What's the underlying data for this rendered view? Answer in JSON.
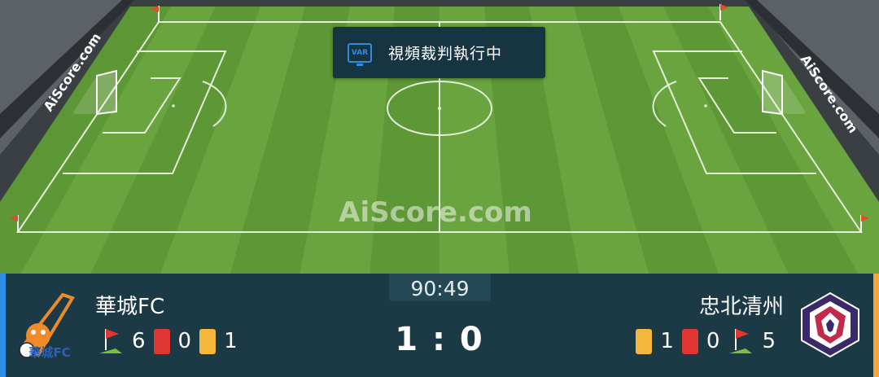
{
  "watermark": "AiScore.com",
  "var_banner": {
    "icon_label": "VAR",
    "text": "視頻裁判執行中"
  },
  "match": {
    "clock": "90:49",
    "score": "1 : 0",
    "home": {
      "name": "華城FC",
      "corners": "6",
      "red_cards": "0",
      "yellow_cards": "1",
      "logo_text": "華城FC"
    },
    "away": {
      "name": "忠北清州",
      "corners": "5",
      "red_cards": "0",
      "yellow_cards": "1"
    }
  },
  "colors": {
    "pitch_light": "#6aa43f",
    "pitch_dark": "#5e9736",
    "scorebar": "#1c3a46",
    "home_accent": "#2f8de4",
    "away_accent": "#f4a83c",
    "red_card": "#e03634",
    "yellow_card": "#f5b63c"
  }
}
